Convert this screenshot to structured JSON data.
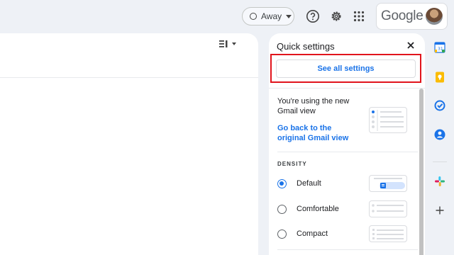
{
  "header": {
    "status": {
      "label": "Away"
    },
    "icons": [
      "help-icon",
      "settings-gear-icon",
      "apps-grid-icon"
    ],
    "brand": {
      "label": "Google"
    }
  },
  "main": {
    "layout_icon": "split-pane-icon"
  },
  "quick_settings": {
    "title": "Quick settings",
    "see_all_label": "See all settings",
    "view_notice": "You're using the new Gmail view",
    "go_back_link": "Go back to the original Gmail view",
    "density": {
      "heading": "DENSITY",
      "options": [
        {
          "label": "Default",
          "selected": true
        },
        {
          "label": "Comfortable",
          "selected": false
        },
        {
          "label": "Compact",
          "selected": false
        }
      ]
    }
  },
  "side_panel": {
    "apps": [
      "calendar-icon",
      "keep-icon",
      "tasks-icon",
      "contacts-icon",
      "slack-icon",
      "add-icon"
    ]
  },
  "colors": {
    "accent": "#1a73e8",
    "highlight": "#e1141c",
    "background": "#eef1f6"
  }
}
